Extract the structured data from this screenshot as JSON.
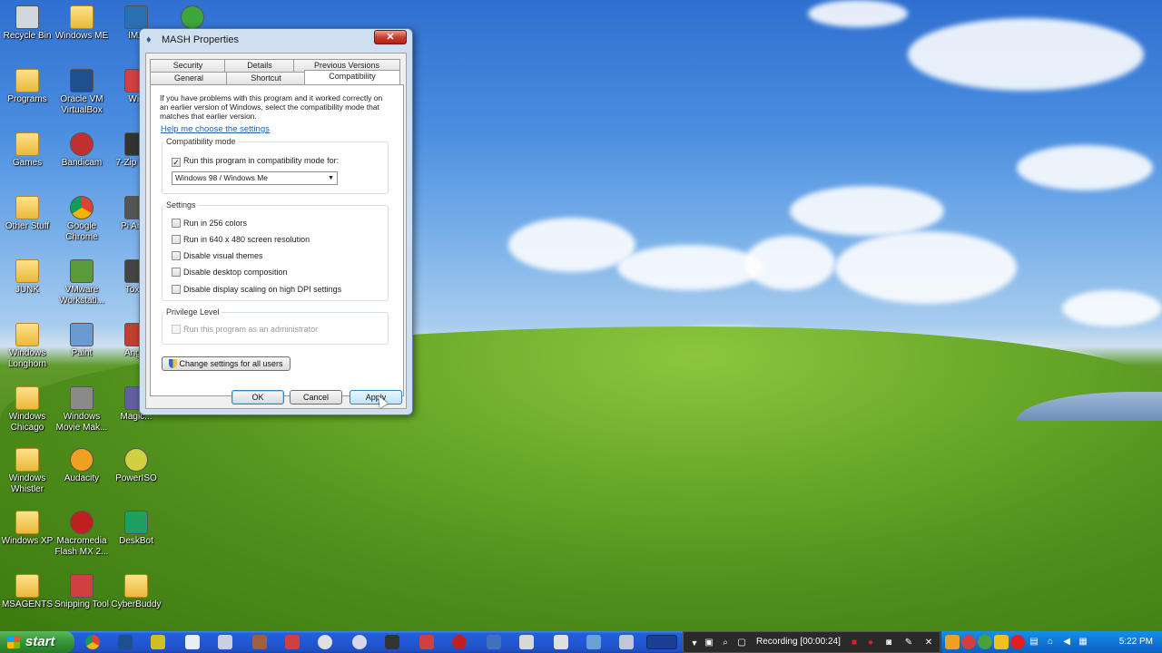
{
  "desktop": {
    "icons": [
      {
        "label": "Recycle Bin",
        "kind": "app",
        "color": "#cfd8dc"
      },
      {
        "label": "Windows ME",
        "kind": "folder"
      },
      {
        "label": "IMA",
        "kind": "app",
        "color": "#2a6fb0"
      },
      {
        "label": "",
        "kind": "app",
        "color": "#3ca63c"
      },
      {
        "label": "Programs",
        "kind": "folder"
      },
      {
        "label": "Oracle VM VirtualBox",
        "kind": "app",
        "color": "#1f4f8f"
      },
      {
        "label": "Win",
        "kind": "app",
        "color": "#d04040"
      },
      {
        "label": "Games",
        "kind": "folder"
      },
      {
        "label": "Bandicam",
        "kind": "app",
        "color": "#c03030"
      },
      {
        "label": "7-Zip Man",
        "kind": "app",
        "color": "#333333"
      },
      {
        "label": "Other Stuff",
        "kind": "folder"
      },
      {
        "label": "Google Chrome",
        "kind": "app",
        "color": "#e0a020"
      },
      {
        "label": "Pi Anim",
        "kind": "app",
        "color": "#555555"
      },
      {
        "label": "JUNK",
        "kind": "folder"
      },
      {
        "label": "VMware Workstati...",
        "kind": "app",
        "color": "#5a9a3a"
      },
      {
        "label": "Tox F",
        "kind": "app",
        "color": "#444444"
      },
      {
        "label": "Windows Longhorn",
        "kind": "folder"
      },
      {
        "label": "Paint",
        "kind": "app",
        "color": "#6a9ad0"
      },
      {
        "label": "Angry",
        "kind": "app",
        "color": "#c04030"
      },
      {
        "label": "Windows Chicago",
        "kind": "folder"
      },
      {
        "label": "Windows Movie Mak...",
        "kind": "app",
        "color": "#8a8a8a"
      },
      {
        "label": "Magic...",
        "kind": "app",
        "color": "#6060a0"
      },
      {
        "label": "Windows Whistler",
        "kind": "folder"
      },
      {
        "label": "Audacity",
        "kind": "app",
        "color": "#f0a020"
      },
      {
        "label": "PowerISO",
        "kind": "app",
        "color": "#d0d040"
      },
      {
        "label": "Windows XP",
        "kind": "folder"
      },
      {
        "label": "Macromedia Flash MX 2...",
        "kind": "app",
        "color": "#c02020"
      },
      {
        "label": "DeskBot",
        "kind": "app",
        "color": "#20a060"
      },
      {
        "label": "MSAGENTS",
        "kind": "folder"
      },
      {
        "label": "Snipping Tool",
        "kind": "app",
        "color": "#d04040"
      },
      {
        "label": "CyberBuddy",
        "kind": "folder"
      }
    ]
  },
  "dialog": {
    "title": "MASH Properties",
    "close": "✕",
    "tabs_row1": [
      "Security",
      "Details",
      "Previous Versions"
    ],
    "tabs_row2": [
      "General",
      "Shortcut",
      "Compatibility"
    ],
    "intro": "If you have problems with this program and it worked correctly on an earlier version of Windows, select the compatibility mode that matches that earlier version.",
    "help_link": "Help me choose the settings",
    "compat_group": "Compatibility mode",
    "compat_check": "Run this program in compatibility mode for:",
    "compat_checked": "✓",
    "compat_value": "Windows 98 / Windows Me",
    "settings_group": "Settings",
    "settings": [
      "Run in 256 colors",
      "Run in 640 x 480 screen resolution",
      "Disable visual themes",
      "Disable desktop composition",
      "Disable display scaling on high DPI settings"
    ],
    "privilege_group": "Privilege Level",
    "privilege_check": "Run this program as an administrator",
    "all_users_button": "Change settings for all users",
    "ok": "OK",
    "cancel": "Cancel",
    "apply": "Apply"
  },
  "taskbar": {
    "start": "start",
    "recording": "Recording [00:00:24]",
    "clock": "5:22 PM"
  }
}
